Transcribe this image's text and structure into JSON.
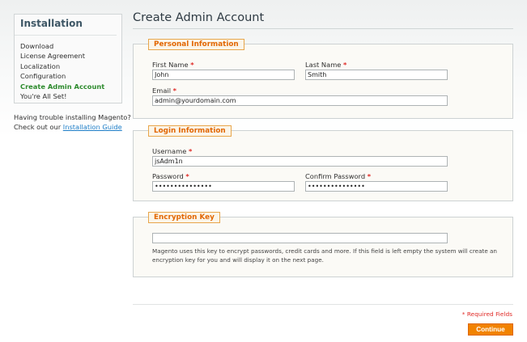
{
  "sidebar": {
    "title": "Installation",
    "steps": [
      {
        "label": "Download",
        "active": false
      },
      {
        "label": "License Agreement",
        "active": false
      },
      {
        "label": "Localization",
        "active": false
      },
      {
        "label": "Configuration",
        "active": false
      },
      {
        "label": "Create Admin Account",
        "active": true
      },
      {
        "label": "You're All Set!",
        "active": false
      }
    ],
    "help_line1": "Having trouble installing Magento?",
    "help_line2_prefix": "Check out our",
    "help_link": "Installation Guide"
  },
  "main": {
    "title": "Create Admin Account",
    "personal": {
      "legend": "Personal Information",
      "first_name_label": "First Name",
      "first_name_value": "John",
      "last_name_label": "Last Name",
      "last_name_value": "Smith",
      "email_label": "Email",
      "email_value": "admin@yourdomain.com"
    },
    "login": {
      "legend": "Login Information",
      "username_label": "Username",
      "username_value": "jsAdm1n",
      "password_label": "Password",
      "password_value": "•••••••••••••••",
      "confirm_label": "Confirm Password",
      "confirm_value": "•••••••••••••••"
    },
    "encryption": {
      "legend": "Encryption Key",
      "value": "",
      "note": "Magento uses this key to encrypt passwords, credit cards and more. If this field is left empty the system will create an encryption key for you and will display it on the next page."
    },
    "required_asterisk": "*",
    "required_note": "* Required Fields",
    "continue_label": "Continue"
  },
  "colors": {
    "accent": "#f18200",
    "legend_text": "#e26703",
    "active_step": "#2e8b2e",
    "required": "#e02b27",
    "link": "#1e7ec8"
  }
}
